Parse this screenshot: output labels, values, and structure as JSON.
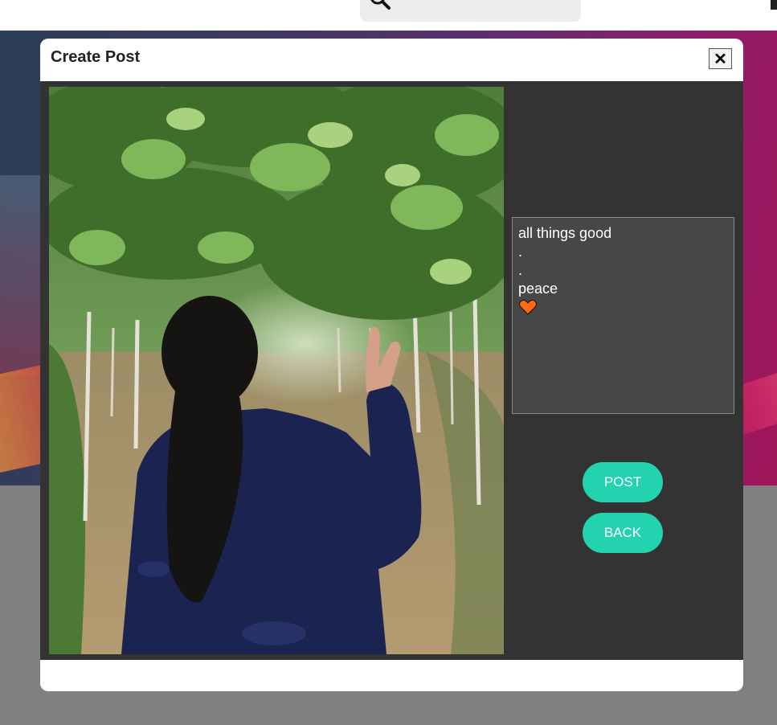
{
  "modal": {
    "title": "Create Post",
    "close_label": "✕"
  },
  "caption": {
    "text": "all things good\n.\n.\npeace",
    "emoji_icon": "orange-heart-icon",
    "emoji_color": "#ff6a13"
  },
  "buttons": {
    "post_label": "POST",
    "back_label": "BACK"
  },
  "colors": {
    "accent": "#23d3b0",
    "panel": "#333333",
    "caption_bg": "#474747"
  },
  "photo": {
    "subject": "woman with ponytail in navy jacket making peace sign in vineyard"
  }
}
